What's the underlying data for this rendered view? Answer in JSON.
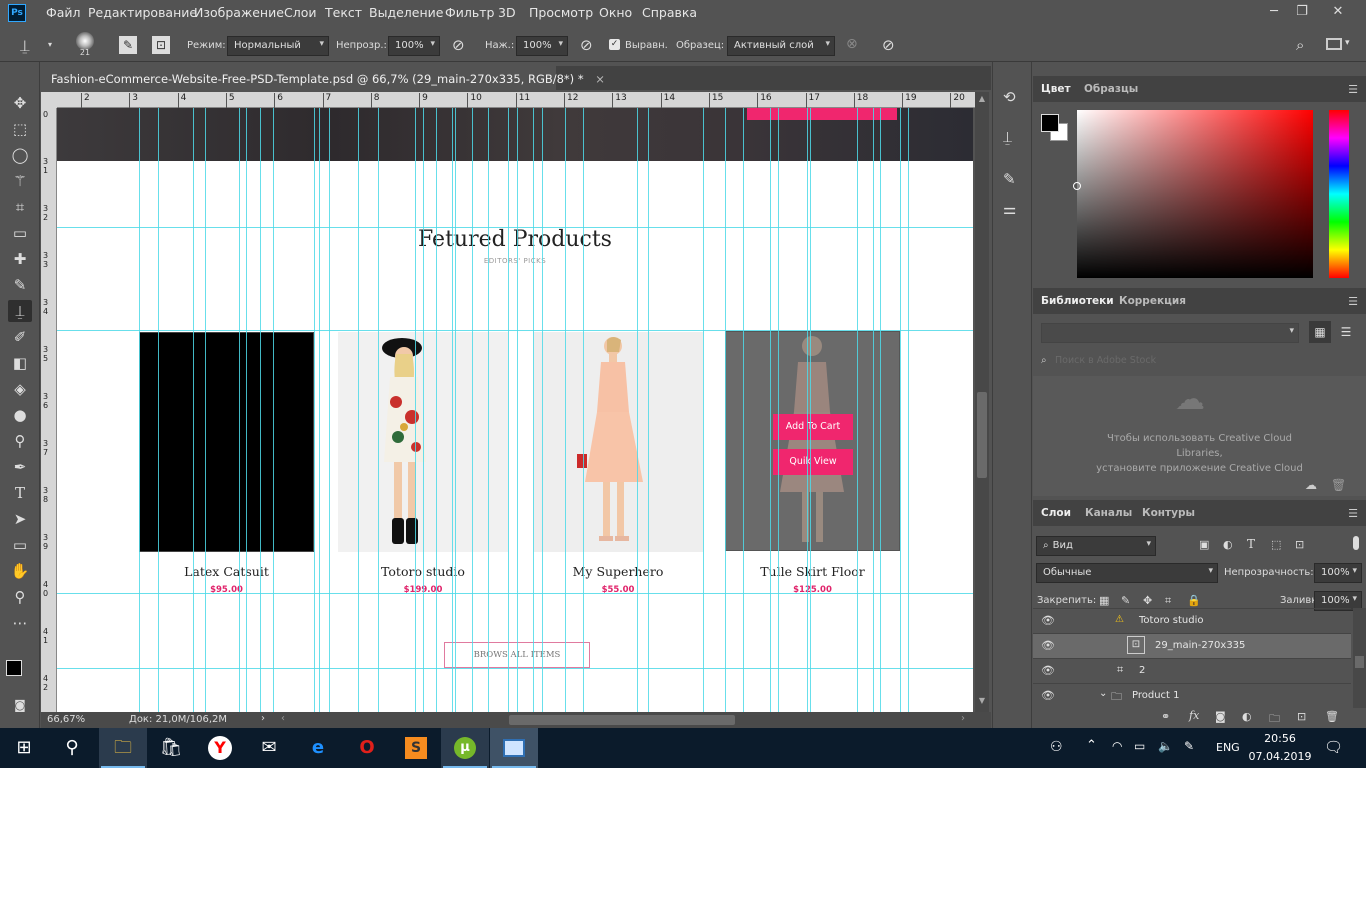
{
  "menu": [
    "Файл",
    "Редактирование",
    "Изображение",
    "Слои",
    "Текст",
    "Выделение",
    "Фильтр",
    "3D",
    "Просмотр",
    "Окно",
    "Справка"
  ],
  "logo": "Ps",
  "window_controls": {
    "minimize": "─",
    "restore": "❐",
    "close": "✕"
  },
  "options": {
    "brush_size": "21",
    "mode_label": "Режим:",
    "mode_value": "Нормальный",
    "opacity_label": "Непрозр.:",
    "opacity_value": "100%",
    "pressure_label": "Наж.:",
    "pressure_value": "100%",
    "align_label": "Выравн.",
    "sample_label": "Образец:",
    "sample_value": "Активный слой"
  },
  "document": {
    "tab_title": "Fashion-eCommerce-Website-Free-PSD-Template.psd @ 66,7% (29_main-270x335, RGB/8*) *",
    "close": "×",
    "zoom": "66,67%",
    "doc_info": "Док: 21,0M/106,2M",
    "ruler_top": [
      "2",
      "3",
      "4",
      "5",
      "6",
      "7",
      "8",
      "9",
      "10",
      "11",
      "12",
      "13",
      "14",
      "15",
      "16",
      "17",
      "18",
      "19",
      "20"
    ],
    "ruler_left": [
      "0",
      "3 1",
      "3 2",
      "3 3",
      "3 4",
      "3 5",
      "3 6",
      "3 7",
      "3 8",
      "3 9",
      "4 0",
      "4 1",
      "4 2"
    ]
  },
  "page": {
    "heading": "Fetured Products",
    "subheading": "EDITORS' PICKS",
    "browse_button": "BROWS ALL ITEMS",
    "add_to_cart": "Add To Cart",
    "quick_view": "Quik View",
    "products": [
      {
        "name": "Latex Catsuit",
        "price": "$95.00"
      },
      {
        "name": "Totoro studio",
        "price": "$199.00"
      },
      {
        "name": "My Superhero",
        "price": "$55.00"
      },
      {
        "name": "Tulle Skirt Floor",
        "price": "$125.00"
      }
    ]
  },
  "color_panel": {
    "tabs": [
      "Цвет",
      "Образцы"
    ]
  },
  "libraries_panel": {
    "tabs": [
      "Библиотеки",
      "Коррекция"
    ],
    "search_placeholder": "Поиск в Adobe Stock",
    "message_line1": "Чтобы использовать Creative Cloud",
    "message_line2": "Libraries,",
    "message_line3": "установите приложение Creative Cloud"
  },
  "layers_panel": {
    "tabs": [
      "Слои",
      "Каналы",
      "Контуры"
    ],
    "filter_label": "Вид",
    "blend_mode": "Обычные",
    "opacity_label": "Непрозрачность:",
    "opacity_value": "100%",
    "lock_label": "Закрепить:",
    "fill_label": "Заливка:",
    "fill_value": "100%",
    "layers": [
      {
        "name": "Totoro studio",
        "type": "text",
        "selected": false
      },
      {
        "name": "29_main-270x335",
        "type": "smart",
        "selected": true
      },
      {
        "name": "2",
        "type": "transform",
        "selected": false
      },
      {
        "name": "Product 1",
        "type": "group",
        "selected": false
      }
    ]
  },
  "taskbar": {
    "lang": "ENG",
    "time": "20:56",
    "date": "07.04.2019"
  },
  "colors": {
    "ps_bg": "#535353",
    "accent_pink": "#f0266e",
    "guide": "#4dd9e8",
    "taskbar": "#0b1b2b"
  }
}
